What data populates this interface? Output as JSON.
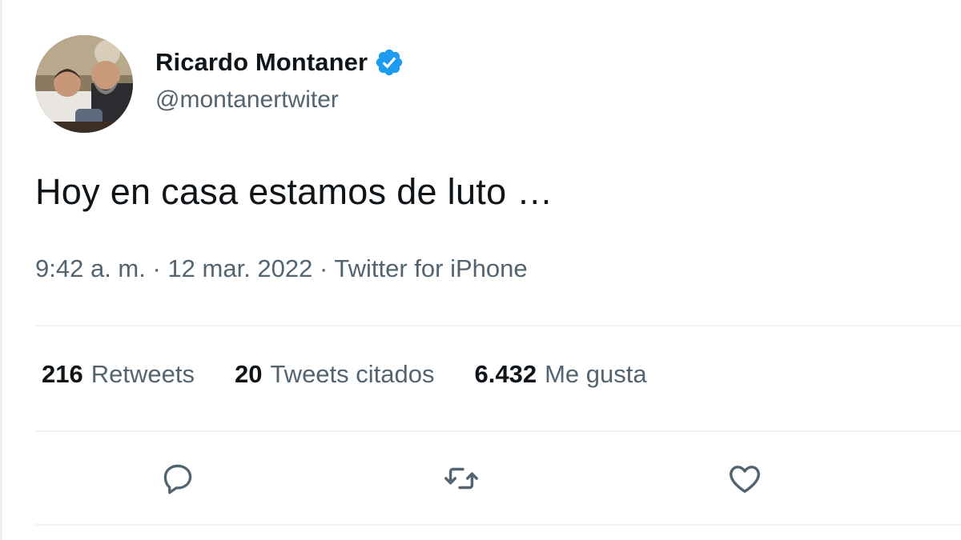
{
  "author": {
    "display_name": "Ricardo Montaner",
    "handle": "@montanertwiter",
    "verified": true,
    "avatar_icon": "profile-photo-icon",
    "verified_icon": "verified-badge-icon"
  },
  "tweet": {
    "text": "Hoy en casa estamos de luto …",
    "time": "9:42 a. m.",
    "separator": " · ",
    "date": "12 mar. 2022",
    "source": "Twitter for iPhone"
  },
  "stats": [
    {
      "count": "216",
      "label": "Retweets"
    },
    {
      "count": "20",
      "label": "Tweets citados"
    },
    {
      "count": "6.432",
      "label": "Me gusta"
    }
  ],
  "actions": [
    {
      "name": "reply",
      "icon": "reply-icon"
    },
    {
      "name": "retweet",
      "icon": "retweet-icon"
    },
    {
      "name": "like",
      "icon": "heart-icon"
    }
  ],
  "colors": {
    "text_primary": "#0f1419",
    "text_secondary": "#536471",
    "verified_blue": "#1d9bf0",
    "divider": "#eff3f4"
  }
}
